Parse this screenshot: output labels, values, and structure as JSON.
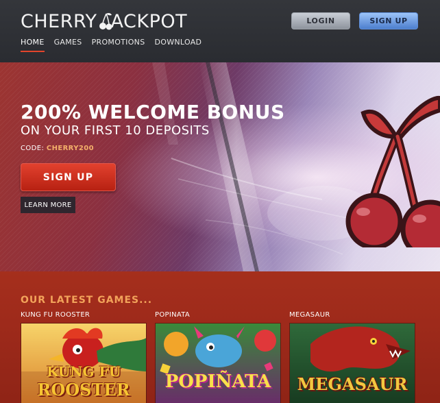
{
  "header": {
    "logo_left": "CHERRY",
    "logo_right": "ACKPOT",
    "login_label": "LOGIN",
    "signup_label": "SIGN UP",
    "nav": [
      {
        "label": "HOME",
        "active": true
      },
      {
        "label": "GAMES",
        "active": false
      },
      {
        "label": "PROMOTIONS",
        "active": false
      },
      {
        "label": "DOWNLOAD",
        "active": false
      }
    ]
  },
  "hero": {
    "title": "200% WELCOME BONUS",
    "subtitle": "ON YOUR FIRST 10 DEPOSITS",
    "code_prefix": "CODE: ",
    "code_value": "CHERRY200",
    "signup_label": "SIGN UP",
    "learn_more_label": "LEARN MORE"
  },
  "games": {
    "section_title": "OUR LATEST GAMES...",
    "items": [
      {
        "name": "KUNG FU ROOSTER",
        "art_line1": "KUNG FU",
        "art_line2": "ROOSTER"
      },
      {
        "name": "POPINATA",
        "art_line1": "POPIÑATA"
      },
      {
        "name": "MEGASAUR",
        "art_line1": "MEGASAUR"
      }
    ]
  },
  "colors": {
    "header_bg": "#2e3035",
    "accent_red": "#e2452b",
    "code_orange": "#f4b06a",
    "games_title_orange": "#f2a35a",
    "games_bg": "#a52f1c",
    "login_grey": "#b8bdc5",
    "signup_blue": "#7aa6e8"
  },
  "icons": {
    "logo_mark": "cherry-logo-icon",
    "hero_art": "cherry-icon"
  }
}
